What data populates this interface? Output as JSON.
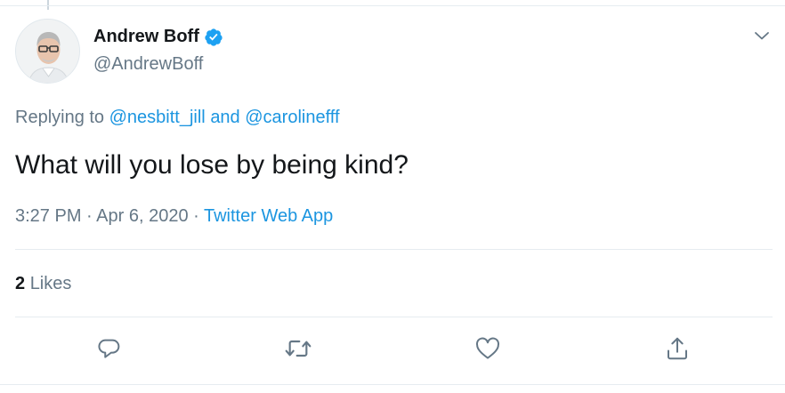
{
  "tweet": {
    "author": {
      "display_name": "Andrew Boff",
      "handle": "@AndrewBoff",
      "verified": true
    },
    "replying_prefix": "Replying to",
    "replying_to": [
      "@nesbitt_jill",
      "@carolinefff"
    ],
    "replying_joiner": "and",
    "text": "What will you lose by being kind?",
    "timestamp": "3:27 PM · Apr 6, 2020",
    "separator": "·",
    "source": "Twitter Web App",
    "likes_count": "2",
    "likes_label": "Likes"
  },
  "icons": {
    "menu": "chevron-down-icon",
    "reply": "reply-icon",
    "retweet": "retweet-icon",
    "like": "heart-icon",
    "share": "share-icon",
    "verified": "verified-badge-icon"
  },
  "colors": {
    "accent": "#1b95e0",
    "verified": "#1da1f2",
    "secondary_text": "#657786",
    "primary_text": "#14171a",
    "divider": "#e6ecf0"
  }
}
